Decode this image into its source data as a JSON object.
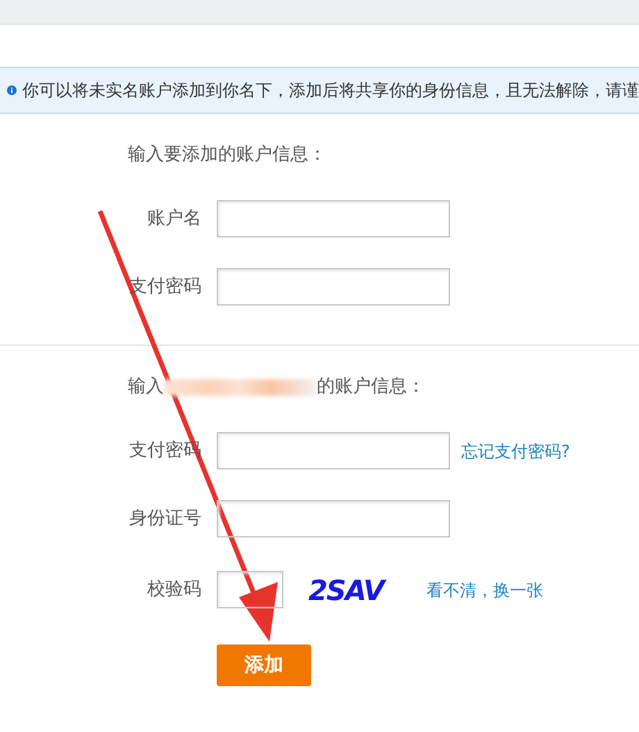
{
  "notice": "你可以将未实名账户添加到你名下，添加后将共享你的身份信息，且无法解除，请谨",
  "section_1": {
    "heading": "输入要添加的账户信息：",
    "fields": [
      {
        "label": "账户名"
      },
      {
        "label": "支付密码"
      }
    ]
  },
  "section_2": {
    "heading_start": "输入",
    "heading_end": "的账户信息：",
    "fields": [
      {
        "label": "支付密码",
        "link": "忘记支付密码?"
      },
      {
        "label": "身份证号"
      }
    ]
  },
  "captcha": {
    "label": "校验码",
    "code": "2SAV",
    "refresh_link": "看不清，换一张"
  },
  "submit_button": "添加"
}
